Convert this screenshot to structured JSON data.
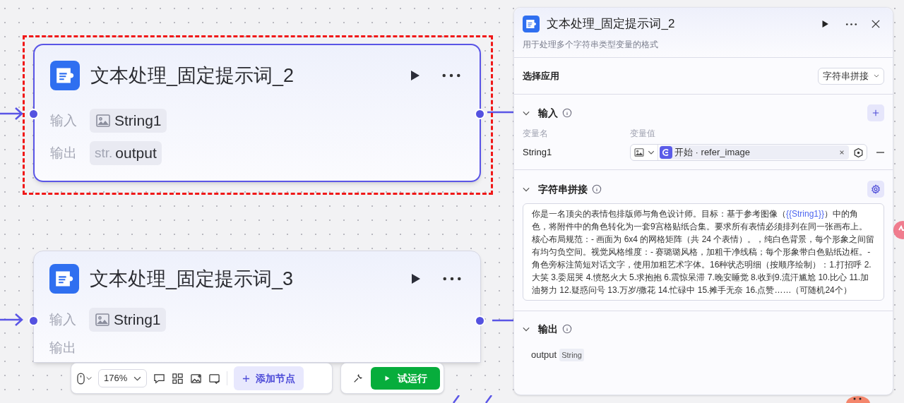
{
  "canvas": {
    "nodes": [
      {
        "title": "文本处理_固定提示词_2",
        "selected": true,
        "input_label": "输入",
        "input": {
          "kind": "image",
          "name": "String1"
        },
        "output_label": "输出",
        "output": {
          "type_label": "str.",
          "name": "output"
        }
      },
      {
        "title": "文本处理_固定提示词_3",
        "selected": false,
        "input_label": "输入",
        "input": {
          "kind": "image",
          "name": "String1"
        },
        "output_label": "输出"
      }
    ]
  },
  "toolbar": {
    "zoom": "176%",
    "add_node": "添加节点",
    "run": "试运行"
  },
  "panel": {
    "title": "文本处理_固定提示词_2",
    "description": "用于处理多个字符串类型变量的格式",
    "app": {
      "label": "选择应用",
      "value": "字符串拼接"
    },
    "input": {
      "title": "输入",
      "expanded": true,
      "col_name": "变量名",
      "col_value": "变量值",
      "rows": [
        {
          "name": "String1",
          "kind": "image",
          "value": "开始 · refer_image"
        }
      ]
    },
    "concat": {
      "title": "字符串拼接",
      "expanded": true,
      "segments": [
        {
          "kind": "text",
          "text": "你是一名顶尖的表情包排版师与角色设计师。目标：基于参考图像（"
        },
        {
          "kind": "variable",
          "text": "{{String1}}"
        },
        {
          "kind": "text",
          "text": "）中的角色，将附件中的角色转化为一套9宫格贴纸合集。要求所有表情必须排列在同一张画布上。核心布局规范：- 画面为 6x4 的网格矩阵（共 24 个表情）。，纯白色背景，每个形象之间留有均匀负空间。视觉风格维度：- 赛璐璐风格，加粗干净线稿；每个形象带白色贴纸边框。- 角色旁标注简短对话文字，使用加粗艺术字体。16种状态明细（按顺序绘制）：1.打招呼 2.大笑 3.委屈哭 4.愤怒火大 5.求抱抱 6.震惊呆滞 7.晚安睡觉 8.收到9.流汗尴尬 10.比心 11.加油努力 12.疑惑问号 13.万岁/撒花 14.忙碌中 15.摊手无奈 16.点赞……（可随机24个）"
        }
      ]
    },
    "output": {
      "title": "输出",
      "expanded": true,
      "name": "output",
      "type": "String"
    }
  }
}
